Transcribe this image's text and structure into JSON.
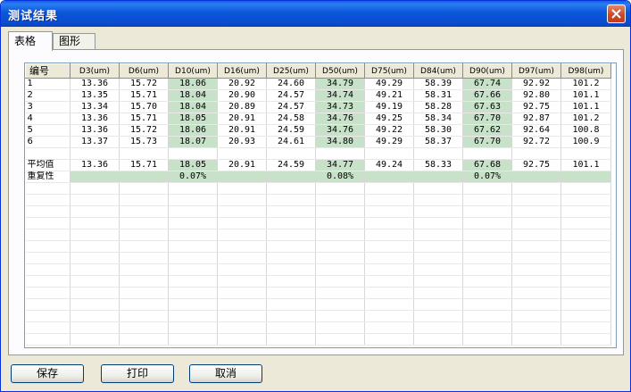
{
  "window": {
    "title": "测试结果"
  },
  "tabs": [
    {
      "label": "表格",
      "active": true
    },
    {
      "label": "图形",
      "active": false
    }
  ],
  "table": {
    "headers": [
      "编号",
      "D3(um)",
      "D6(um)",
      "D10(um)",
      "D16(um)",
      "D25(um)",
      "D50(um)",
      "D75(um)",
      "D84(um)",
      "D90(um)",
      "D97(um)",
      "D98(um)"
    ],
    "highlight_columns": [
      3,
      6,
      9
    ],
    "rows": [
      [
        "1",
        "13.36",
        "15.72",
        "18.06",
        "20.92",
        "24.60",
        "34.79",
        "49.29",
        "58.39",
        "67.74",
        "92.92",
        "101.2"
      ],
      [
        "2",
        "13.35",
        "15.71",
        "18.04",
        "20.90",
        "24.57",
        "34.74",
        "49.21",
        "58.31",
        "67.66",
        "92.80",
        "101.1"
      ],
      [
        "3",
        "13.34",
        "15.70",
        "18.04",
        "20.89",
        "24.57",
        "34.73",
        "49.19",
        "58.28",
        "67.63",
        "92.75",
        "101.1"
      ],
      [
        "4",
        "13.36",
        "15.71",
        "18.05",
        "20.91",
        "24.58",
        "34.76",
        "49.25",
        "58.34",
        "67.70",
        "92.87",
        "101.2"
      ],
      [
        "5",
        "13.36",
        "15.72",
        "18.06",
        "20.91",
        "24.59",
        "34.76",
        "49.22",
        "58.30",
        "67.62",
        "92.64",
        "100.8"
      ],
      [
        "6",
        "13.37",
        "15.73",
        "18.07",
        "20.93",
        "24.61",
        "34.80",
        "49.29",
        "58.37",
        "67.70",
        "92.72",
        "100.9"
      ]
    ],
    "average": [
      "平均值",
      "13.36",
      "15.71",
      "18.05",
      "20.91",
      "24.59",
      "34.77",
      "49.24",
      "58.33",
      "67.68",
      "92.75",
      "101.1"
    ],
    "repeatability": [
      "重复性",
      "",
      "",
      "0.07%",
      "",
      "",
      "0.08%",
      "",
      "",
      "0.07%",
      "",
      ""
    ]
  },
  "buttons": {
    "save": "保存",
    "print": "打印",
    "cancel": "取消"
  },
  "colors": {
    "highlight": "#C7E2C9",
    "titlebar": "#0A4DD0"
  }
}
